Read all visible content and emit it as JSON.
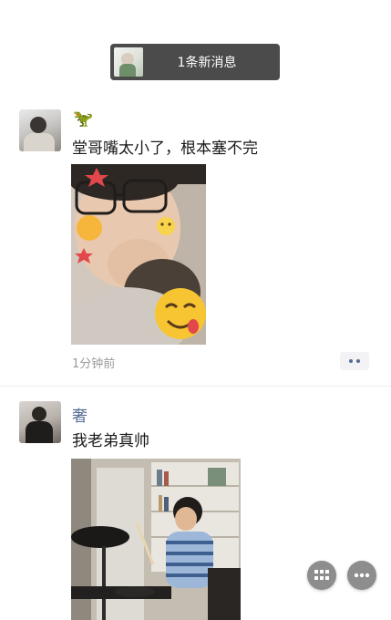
{
  "notification": {
    "text": "1条新消息",
    "avatar_icon": "avatar-thumbnail"
  },
  "posts": [
    {
      "author_emoji": "🦖",
      "text": "堂哥嘴太小了，根本塞不完",
      "time": "1分钟前",
      "image": "photo of a boy with glasses eating, decorated with emoji stickers"
    },
    {
      "author_name": "奢",
      "text": "我老弟真帅",
      "image": "photo of a boy playing an electronic drum kit"
    }
  ],
  "colors": {
    "name_link": "#566b94",
    "notification_bg": "#4b4b4b",
    "fab_bg": "#8d8d8d",
    "timestamp": "#9a9a9a"
  },
  "icons": {
    "more": "more-dots-icon",
    "grid": "grid-icon",
    "ellipsis": "ellipsis-icon"
  }
}
